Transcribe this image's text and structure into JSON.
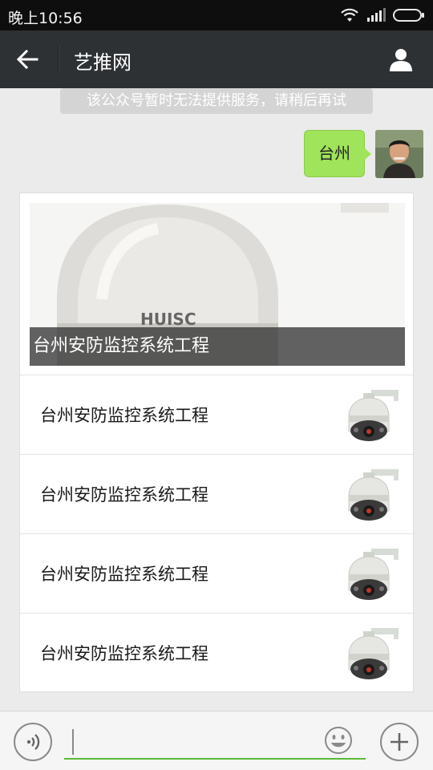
{
  "status_bar": {
    "time": "晚上10:56"
  },
  "header": {
    "title": "艺推网",
    "back_icon": "arrow-left-icon",
    "profile_icon": "person-icon"
  },
  "system_notice": "该公众号暂时无法提供服务，请稍后再试",
  "messages": [
    {
      "direction": "sent",
      "text": "台州"
    }
  ],
  "article_card": {
    "cover": {
      "title": "台州安防监控系统工程",
      "image_brand_text": "HUISC"
    },
    "items": [
      {
        "title": "台州安防监控系统工程"
      },
      {
        "title": "台州安防监控系统工程"
      },
      {
        "title": "台州安防监控系统工程"
      },
      {
        "title": "台州安防监控系统工程"
      }
    ]
  },
  "input_bar": {
    "value": "",
    "voice_icon": "voice-icon",
    "emoji_icon": "emoji-icon",
    "plus_icon": "plus-icon"
  },
  "colors": {
    "status_bar": "#0e0e0e",
    "title_bar": "#2d3134",
    "sent_bubble": "#9fe45a",
    "input_underline": "#5ab93a",
    "chat_background": "#ebebeb"
  }
}
